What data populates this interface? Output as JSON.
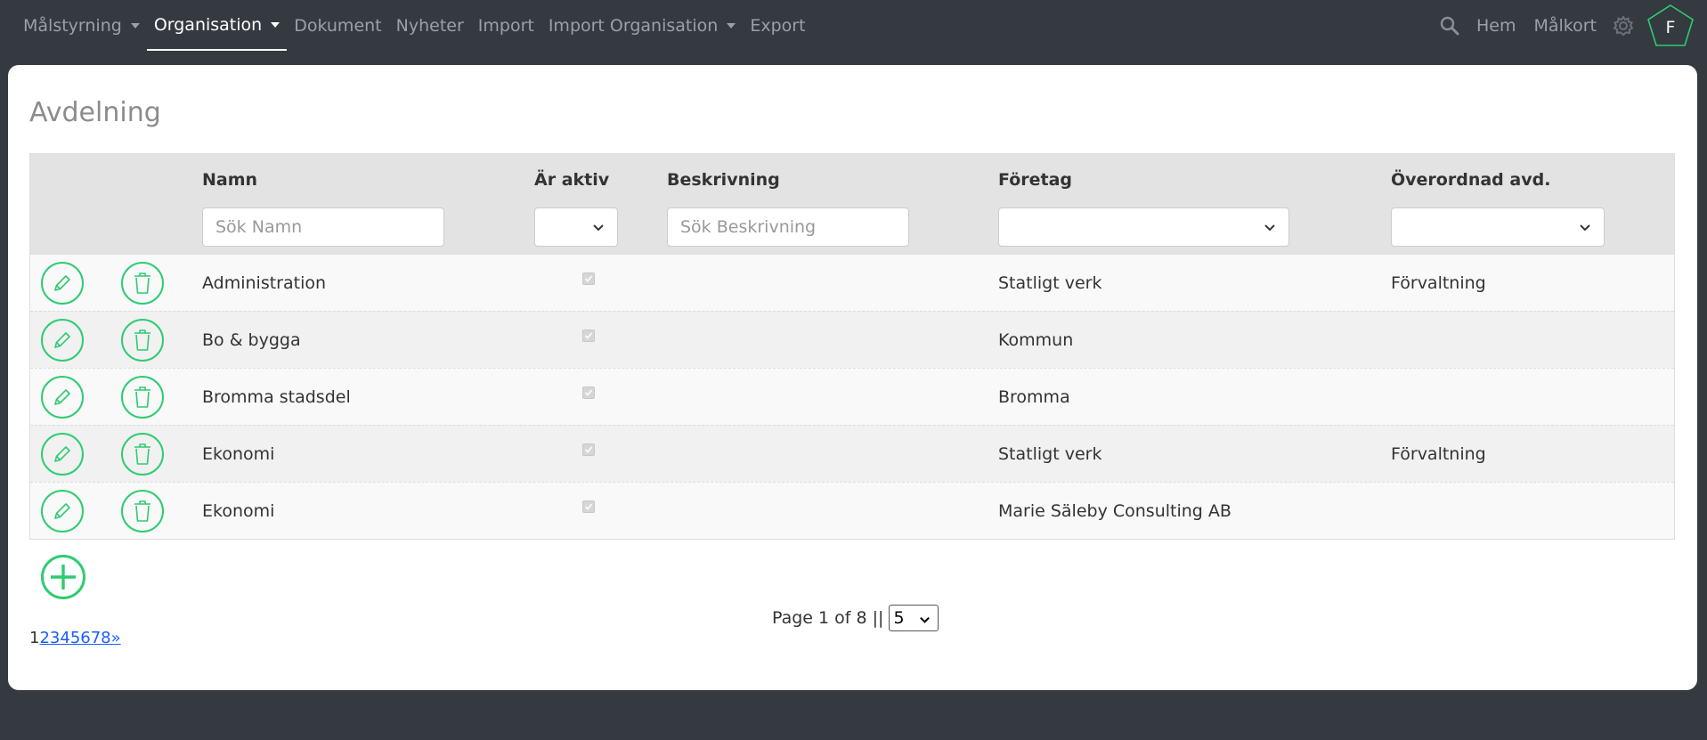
{
  "nav": {
    "left": [
      {
        "label": "Målstyrning",
        "dropdown": true,
        "active": false
      },
      {
        "label": "Organisation",
        "dropdown": true,
        "active": true
      },
      {
        "label": "Dokument",
        "dropdown": false,
        "active": false
      },
      {
        "label": "Nyheter",
        "dropdown": false,
        "active": false
      },
      {
        "label": "Import",
        "dropdown": false,
        "active": false
      },
      {
        "label": "Import Organisation",
        "dropdown": true,
        "active": false
      },
      {
        "label": "Export",
        "dropdown": false,
        "active": false
      }
    ],
    "right": {
      "search_icon": "search-icon",
      "home_label": "Hem",
      "card_label": "Målkort",
      "settings_icon": "gear-icon",
      "avatar_initial": "F"
    }
  },
  "page": {
    "title": "Avdelning"
  },
  "table": {
    "headers": {
      "name": "Namn",
      "active": "Är aktiv",
      "description": "Beskrivning",
      "company": "Företag",
      "parent": "Överordnad avd."
    },
    "filters": {
      "name_placeholder": "Sök Namn",
      "description_placeholder": "Sök Beskrivning",
      "active_value": "",
      "company_value": "",
      "parent_value": ""
    },
    "rows": [
      {
        "name": "Administration",
        "active": true,
        "description": "",
        "company": "Statligt verk",
        "parent": "Förvaltning"
      },
      {
        "name": "Bo & bygga",
        "active": true,
        "description": "",
        "company": "Kommun",
        "parent": ""
      },
      {
        "name": "Bromma stadsdel",
        "active": true,
        "description": "",
        "company": "Bromma",
        "parent": ""
      },
      {
        "name": "Ekonomi",
        "active": true,
        "description": "",
        "company": "Statligt verk",
        "parent": "Förvaltning"
      },
      {
        "name": "Ekonomi",
        "active": true,
        "description": "",
        "company": "Marie Säleby Consulting AB",
        "parent": ""
      }
    ]
  },
  "pagination": {
    "text": "Page 1 of 8 ||",
    "page_size": "5",
    "current": "1",
    "links": [
      "2",
      "3",
      "4",
      "5",
      "6",
      "7",
      "8",
      "»"
    ]
  },
  "colors": {
    "accent": "#2ecc71",
    "navbar": "#343a40",
    "link": "#1a5cff"
  }
}
